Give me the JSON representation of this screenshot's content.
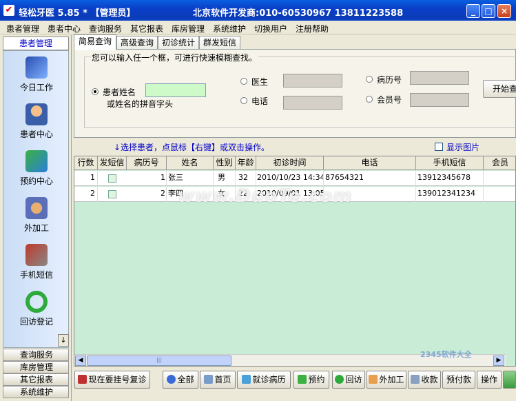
{
  "window": {
    "title": "轻松牙医 5.85 * 【管理员】",
    "developer": "北京软件开发商:010-60530967  13811223588",
    "buttons": [
      "_",
      "□",
      "×"
    ]
  },
  "menu": [
    "患者管理",
    "患者中心",
    "查询服务",
    "其它报表",
    "库房管理",
    "系统维护",
    "切换用户",
    "注册帮助"
  ],
  "sidebar": {
    "header": "患者管理",
    "items": [
      {
        "label": "今日工作",
        "icon": "today-work-icon"
      },
      {
        "label": "患者中心",
        "icon": "patient-center-icon"
      },
      {
        "label": "预约中心",
        "icon": "appointment-icon"
      },
      {
        "label": "外加工",
        "icon": "outsourcing-icon"
      },
      {
        "label": "手机短信",
        "icon": "sms-icon"
      },
      {
        "label": "回访登记",
        "icon": "followup-icon"
      }
    ],
    "scroll_down": "↓",
    "buttons": [
      "查询服务",
      "库房管理",
      "其它报表",
      "系统维护"
    ]
  },
  "tabs": [
    "简易查询",
    "高级查询",
    "初诊统计",
    "群发短信"
  ],
  "search": {
    "group_label": "您可以输入任一个框，可进行快速模糊查找。",
    "name_label": "患者姓名",
    "name_hint": "或姓名的拼音字头",
    "doctor_label": "医生",
    "phone_label": "电话",
    "record_label": "病历号",
    "member_label": "会员号",
    "start_button": "开始查"
  },
  "hint": "↓选择患者，点鼠标【右键】或双击操作。",
  "show_photo": "显示图片",
  "grid": {
    "columns": [
      "行数",
      "发短信",
      "病历号",
      "姓名",
      "性别",
      "年龄",
      "初诊时间",
      "电话",
      "手机短信",
      "会员"
    ],
    "rows": [
      {
        "n": "1",
        "record": "1",
        "name": "张三",
        "sex": "男",
        "age": "32",
        "time": "2010/10/23 14:34",
        "phone": "87654321",
        "mobile": "13912345678"
      },
      {
        "n": "2",
        "record": "2",
        "name": "李四",
        "sex": "女",
        "age": "22",
        "time": "2010/09/01 13:05",
        "phone": "",
        "mobile": "139012341234"
      }
    ]
  },
  "bottom_buttons": [
    "现在要挂号复诊",
    "全部",
    "首页",
    "就诊病历",
    "预约",
    "回访",
    "外加工",
    "收款",
    "预付款",
    "操作"
  ],
  "watermark": "www.DuoTe.com",
  "watermark2": "2345软件大全"
}
